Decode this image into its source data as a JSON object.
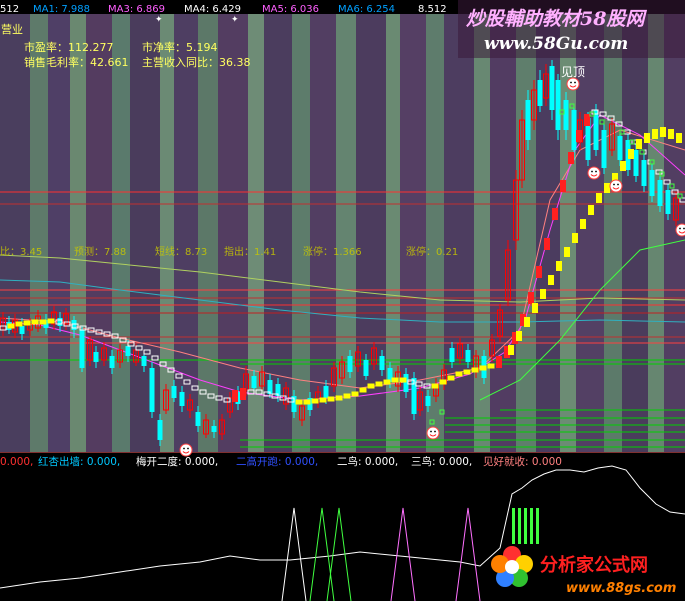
{
  "ma_bar": [
    {
      "text": "512",
      "color": "#ffffff"
    },
    {
      "text": "MA1: 7.988",
      "color": "#00a0ff"
    },
    {
      "text": "MA3: 6.869",
      "color": "#ff60ff"
    },
    {
      "text": "MA4: 6.429",
      "color": "#ffffff"
    },
    {
      "text": "MA5: 6.036",
      "color": "#ff60ff"
    },
    {
      "text": "MA6: 6.254",
      "color": "#00a0ff"
    },
    {
      "text": "8.512",
      "color": "#ffffff"
    }
  ],
  "sector_label": "营业",
  "fundamentals": {
    "pe": "市盈率：112.277",
    "pb": "市净率：5.194",
    "gross_margin": "销售毛利率：42.661",
    "revenue_yoy": "主营收入同比：36.38"
  },
  "stats_row": [
    {
      "text": "比：3.45",
      "color": "#c8c800"
    },
    {
      "text": "预测：7.88",
      "color": "#c8c800"
    },
    {
      "text": "短线：8.73",
      "color": "#c8c800"
    },
    {
      "text": "指出：1.41",
      "color": "#c8c800"
    },
    {
      "text": "涨停：1.366",
      "color": "#c8c800"
    },
    {
      "text": "涨停：0.21",
      "color": "#c8c800"
    }
  ],
  "top_label": "见顶",
  "bottom_indicator": [
    {
      "text": "0.000,",
      "color": "#ff3030"
    },
    {
      "text": "红杏出墙: 0.000,",
      "color": "#00c8ff"
    },
    {
      "text": "梅开二度: 0.000,",
      "color": "#ffffff"
    },
    {
      "text": "二高开跑: 0.000,",
      "color": "#3050ff"
    },
    {
      "text": "二鸟: 0.000,",
      "color": "#ffffff"
    },
    {
      "text": "三鸟: 0.000,",
      "color": "#ffffff"
    },
    {
      "text": "见好就收: 0.000",
      "color": "#ff8080"
    }
  ],
  "watermark_top": {
    "title": "炒股輔助教材58股网",
    "url": "www.58Gu.com"
  },
  "watermark_bottom": {
    "title": "分析家公式网",
    "url": "www.88gs.com"
  },
  "colors": {
    "up": "#ff0000",
    "down": "#00ffff",
    "ribbon_up": "#ff2020",
    "ribbon_mid": "#ffff00",
    "ribbon_down": "#ffffff",
    "green_line": "#00d000"
  }
}
